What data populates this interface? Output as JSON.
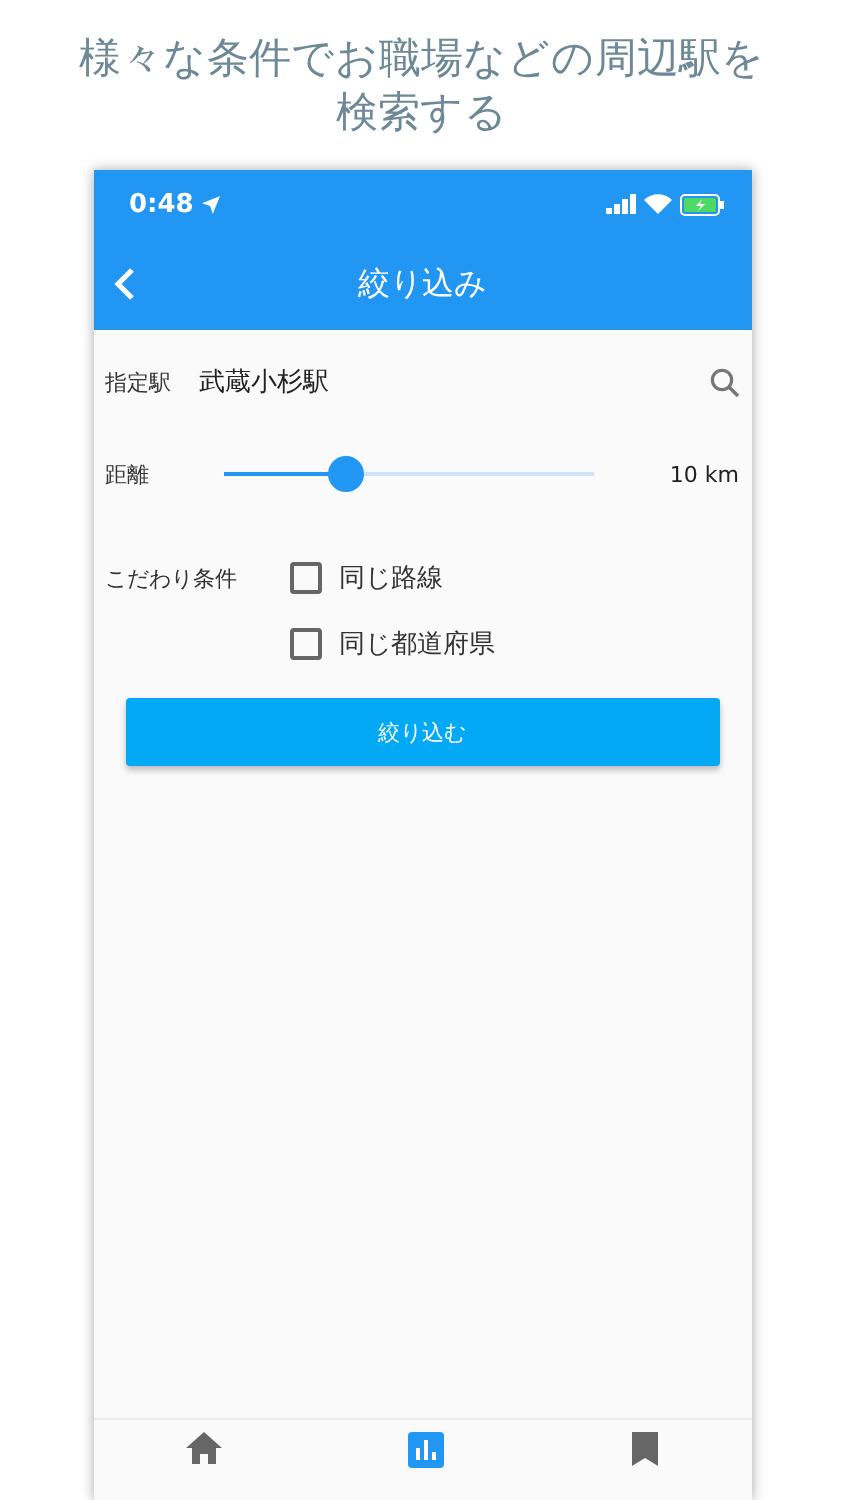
{
  "caption": "様々な条件でお職場などの周辺駅を検索する",
  "status_bar": {
    "time": "0:48"
  },
  "header": {
    "title": "絞り込み"
  },
  "station": {
    "label": "指定駅",
    "value": "武蔵小杉駅"
  },
  "distance": {
    "label": "距離",
    "level": 0.33,
    "reading": "10 km"
  },
  "conditions": {
    "label": "こだわり条件",
    "options": [
      {
        "label": "同じ路線",
        "checked": false
      },
      {
        "label": "同じ都道府県",
        "checked": false
      }
    ]
  },
  "submit": {
    "label": "絞り込む"
  },
  "tabs": [
    {
      "kind": "home",
      "selected": false
    },
    {
      "kind": "ranking",
      "selected": true
    },
    {
      "kind": "bookmark",
      "selected": false
    }
  ]
}
